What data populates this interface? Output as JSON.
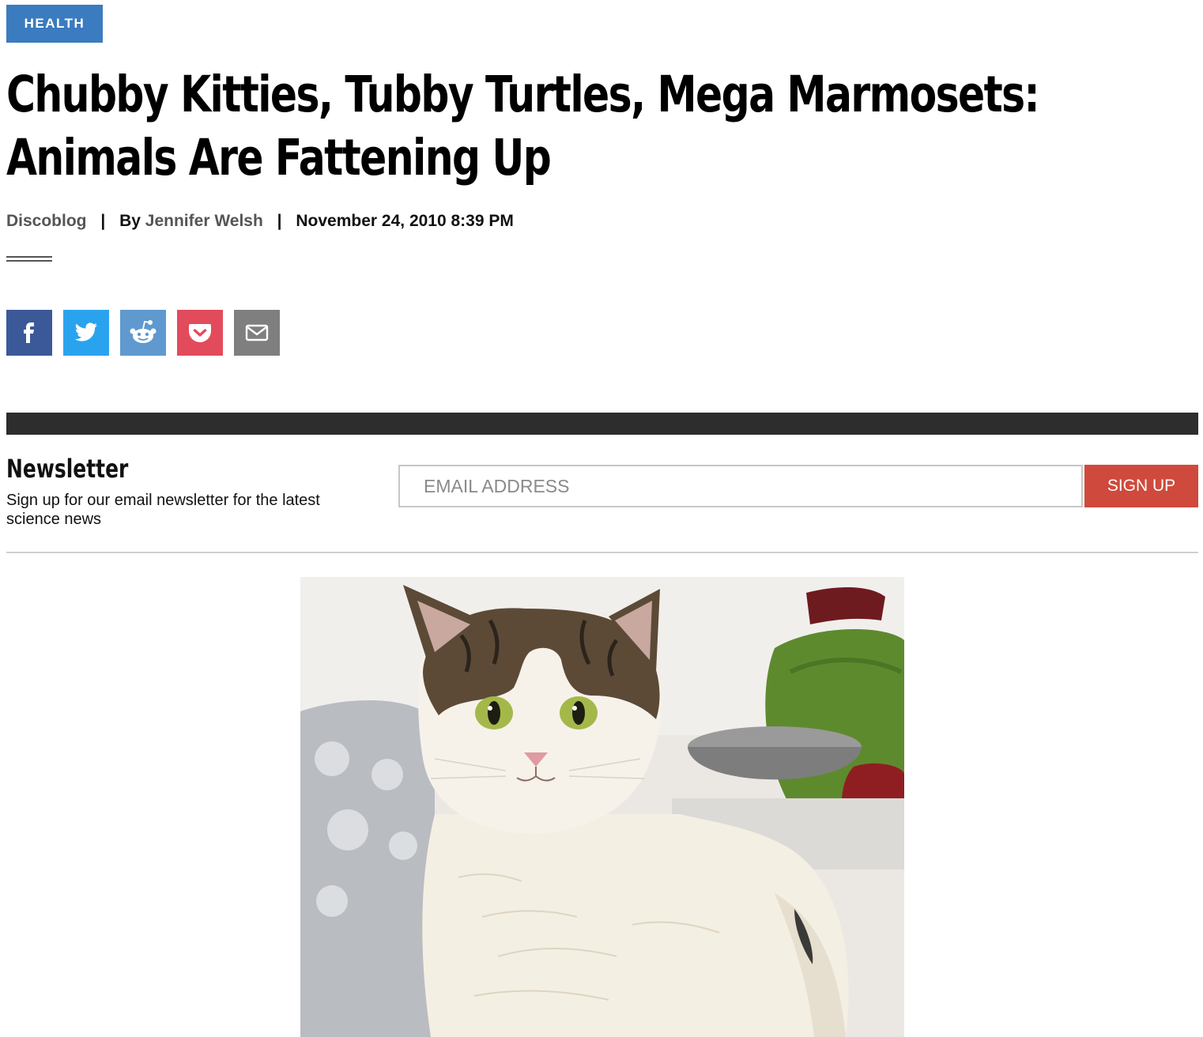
{
  "category": {
    "label": "HEALTH",
    "color": "#3b7bbf"
  },
  "article": {
    "title": "Chubby Kitties, Tubby Turtles, Mega Marmosets: Animals Are Fattening Up",
    "blog": "Discoblog",
    "by_prefix": "By",
    "author": "Jennifer Welsh",
    "separator": "|",
    "date": "November 24, 2010 8:39 PM"
  },
  "share": {
    "buttons": [
      {
        "name": "facebook",
        "icon": "facebook-icon",
        "color": "#3b5998"
      },
      {
        "name": "twitter",
        "icon": "twitter-icon",
        "color": "#2aa3ef"
      },
      {
        "name": "reddit",
        "icon": "reddit-icon",
        "color": "#5f99cf"
      },
      {
        "name": "pocket",
        "icon": "pocket-icon",
        "color": "#e24b5b"
      },
      {
        "name": "email",
        "icon": "envelope-icon",
        "color": "#7f7f7f"
      }
    ]
  },
  "newsletter": {
    "title": "Newsletter",
    "description": "Sign up for our email newsletter for the latest science news",
    "email_placeholder": "EMAIL ADDRESS",
    "signup_label": "SIGN UP",
    "signup_color": "#cf4a3c"
  },
  "hero_image": {
    "subject": "fat-white-and-tabby-cat-photo"
  }
}
